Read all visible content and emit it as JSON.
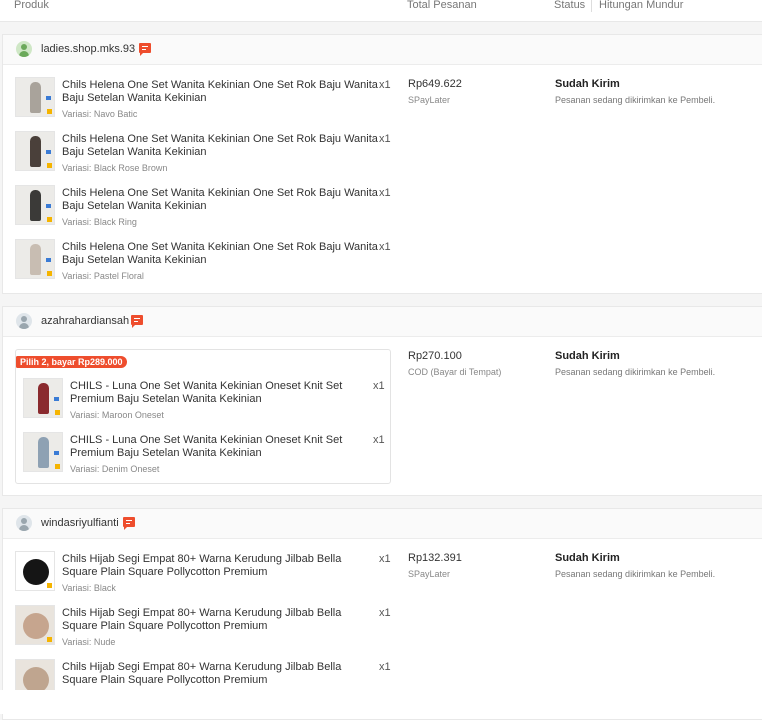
{
  "columns": {
    "product": "Produk",
    "total": "Total Pesanan",
    "status": "Status",
    "countdown": "Hitungan Mundur"
  },
  "orders": [
    {
      "shop": "ladies.shop.mks.93",
      "price": "Rp649.622",
      "payment": "SPayLater",
      "status": "Sudah Kirim",
      "status_desc": "Pesanan sedang dikirimkan ke Pembeli.",
      "items": [
        {
          "title": "Chils Helena One Set Wanita Kekinian One Set Rok Baju Wanita Baju Setelan Wanita Kekinian",
          "qty": "x1",
          "variant": "Variasi: Navo Batic"
        },
        {
          "title": "Chils Helena One Set Wanita Kekinian One Set Rok Baju Wanita Baju Setelan Wanita Kekinian",
          "qty": "x1",
          "variant": "Variasi: Black Rose Brown"
        },
        {
          "title": "Chils Helena One Set Wanita Kekinian One Set Rok Baju Wanita Baju Setelan Wanita Kekinian",
          "qty": "x1",
          "variant": "Variasi: Black Ring"
        },
        {
          "title": "Chils Helena One Set Wanita Kekinian One Set Rok Baju Wanita Baju Setelan Wanita Kekinian",
          "qty": "x1",
          "variant": "Variasi: Pastel Floral"
        }
      ]
    },
    {
      "shop": "azahrahardiansah",
      "price": "Rp270.100",
      "payment": "COD (Bayar di Tempat)",
      "status": "Sudah Kirim",
      "status_desc": "Pesanan sedang dikirimkan ke Pembeli.",
      "bundle_label": "Pilih 2, bayar Rp289.000",
      "items": [
        {
          "title": "CHILS - Luna One Set Wanita Kekinian Oneset Knit Set Premium Baju Setelan Wanita Kekinian",
          "qty": "x1",
          "variant": "Variasi: Maroon Oneset"
        },
        {
          "title": "CHILS - Luna One Set Wanita Kekinian Oneset Knit Set Premium Baju Setelan Wanita Kekinian",
          "qty": "x1",
          "variant": "Variasi: Denim Oneset"
        }
      ]
    },
    {
      "shop": "windasriyulfianti",
      "price": "Rp132.391",
      "payment": "SPayLater",
      "status": "Sudah Kirim",
      "status_desc": "Pesanan sedang dikirimkan ke Pembeli.",
      "items": [
        {
          "title": "Chils Hijab Segi Empat 80+ Warna Kerudung Jilbab Bella Square Plain Square Pollycotton Premium",
          "qty": "x1",
          "variant": "Variasi: Black"
        },
        {
          "title": "Chils Hijab Segi Empat 80+ Warna Kerudung Jilbab Bella Square Plain Square Pollycotton Premium",
          "qty": "x1",
          "variant": "Variasi: Nude"
        },
        {
          "title": "Chils Hijab Segi Empat 80+ Warna Kerudung Jilbab Bella Square Plain Square Pollycotton Premium",
          "qty": "x1",
          "variant": ""
        }
      ]
    }
  ],
  "colors": {
    "accent": "#ee4d2d"
  }
}
